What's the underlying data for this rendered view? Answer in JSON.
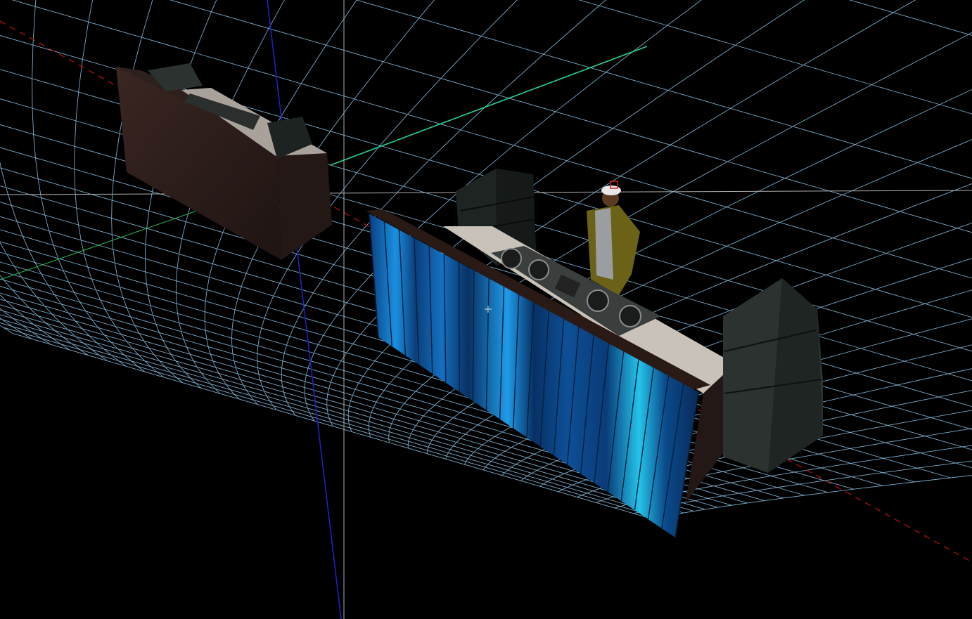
{
  "app": {
    "view": "3d-perspective-viewport",
    "background_color": "#000000",
    "grid_color": "#9fd4f0",
    "axis_colors": {
      "x": "#cc1111",
      "y": "#22cc88",
      "z": "#2222cc"
    }
  },
  "scene": {
    "objects": [
      {
        "name": "dj-booth-back",
        "color": "#2a1a16"
      },
      {
        "name": "dj-booth-front",
        "panel_color": "#1e8fd6",
        "top_color": "#c8c2b8"
      },
      {
        "name": "speaker-stack-left",
        "color": "#232927"
      },
      {
        "name": "speaker-stack-right",
        "color": "#2b3230"
      },
      {
        "name": "dj-avatar",
        "jacket_color": "#6b6218",
        "shirt_color": "#9a9ea0",
        "hat_color": "#e8e8e8"
      }
    ],
    "turntables": [
      "cdj-1",
      "cdj-2",
      "mixer",
      "cdj-3",
      "cdj-4"
    ]
  },
  "cursor": {
    "icon": "crosshair-icon"
  },
  "selection": {
    "icon": "selection-marker-icon",
    "color": "#d02020"
  }
}
